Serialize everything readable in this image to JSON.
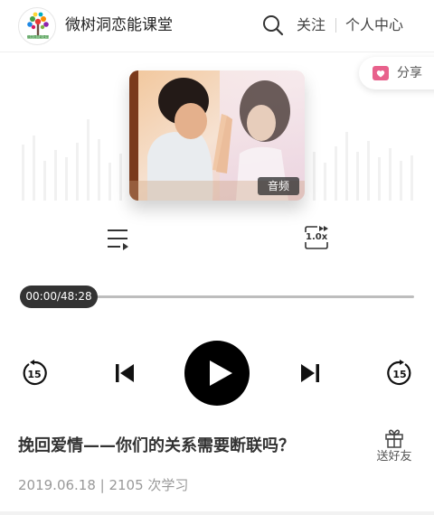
{
  "header": {
    "logo_icon": "tree-logo",
    "logo_text": "微树洞恋能课堂",
    "app_title": "微树洞恋能课堂",
    "search_icon": "search-icon",
    "follow_label": "关注",
    "user_center_label": "个人中心"
  },
  "share": {
    "icon": "heart-share-icon",
    "label": "分享",
    "accent": "#e8618c"
  },
  "cover": {
    "badge": "音频"
  },
  "controls": {
    "playlist_icon": "playlist-icon",
    "speed_label": "1.0x",
    "rewind_label": "15",
    "forward_label": "15",
    "play_icon": "play-icon",
    "prev_icon": "skip-previous-icon",
    "next_icon": "skip-next-icon"
  },
  "progress": {
    "time_label": "00:00/48:28",
    "current": "00:00",
    "duration": "48:28",
    "fraction": 0
  },
  "lesson": {
    "title": "挽回爱情——你们的关系需要断联吗？",
    "date": "2019.06.18",
    "learners": "2105 次学习",
    "meta_line": "2019.06.18 | 2105 次学习"
  },
  "gift": {
    "icon": "gift-icon",
    "label": "送好友"
  }
}
